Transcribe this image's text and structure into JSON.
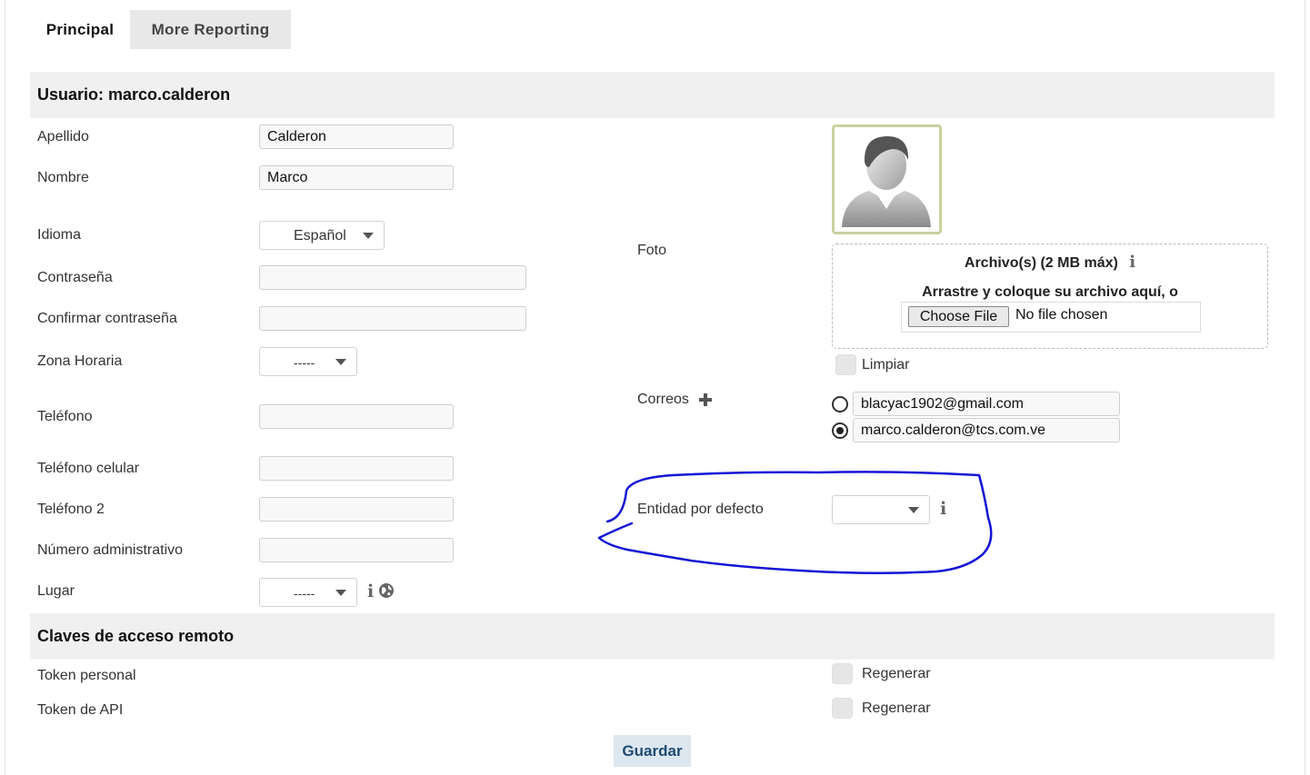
{
  "tabs": {
    "principal": "Principal",
    "more_reporting": "More Reporting"
  },
  "section_user": "Usuario: marco.calderon",
  "fields": {
    "apellido": {
      "label": "Apellido",
      "value": "Calderon"
    },
    "nombre": {
      "label": "Nombre",
      "value": "Marco"
    },
    "idioma": {
      "label": "Idioma",
      "value": "Español"
    },
    "contrasena": {
      "label": "Contraseña",
      "value": ""
    },
    "confirmar": {
      "label": "Confirmar contraseña",
      "value": ""
    },
    "zona": {
      "label": "Zona Horaria",
      "value": "-----"
    },
    "telefono": {
      "label": "Teléfono",
      "value": ""
    },
    "celular": {
      "label": "Teléfono celular",
      "value": ""
    },
    "telefono2": {
      "label": "Teléfono 2",
      "value": ""
    },
    "numero_admin": {
      "label": "Número administrativo",
      "value": ""
    },
    "lugar": {
      "label": "Lugar",
      "value": "-----"
    }
  },
  "foto": {
    "label": "Foto",
    "archivo_title": "Archivo(s) (2 MB máx)",
    "drag_text": "Arrastre y coloque su archivo aquí, o",
    "choose_file": "Choose File",
    "no_file": "No file chosen",
    "limpiar": "Limpiar"
  },
  "correos": {
    "label": "Correos",
    "items": [
      {
        "email": "blacyac1902@gmail.com",
        "selected": false
      },
      {
        "email": "marco.calderon@tcs.com.ve",
        "selected": true
      }
    ]
  },
  "entidad": {
    "label": "Entidad por defecto",
    "value": ""
  },
  "section_claves": "Claves de acceso remoto",
  "tokens": {
    "personal": {
      "label": "Token personal",
      "action": "Regenerar"
    },
    "api": {
      "label": "Token de API",
      "action": "Regenerar"
    }
  },
  "save_label": "Guardar",
  "colors": {
    "annotation": "#1414d6",
    "save_text": "#1f4b73",
    "avatar_border": "#c9d19f"
  },
  "icons": [
    "info-icon",
    "globe-icon",
    "plus-icon",
    "user-avatar-icon",
    "dropdown-caret-icon"
  ]
}
